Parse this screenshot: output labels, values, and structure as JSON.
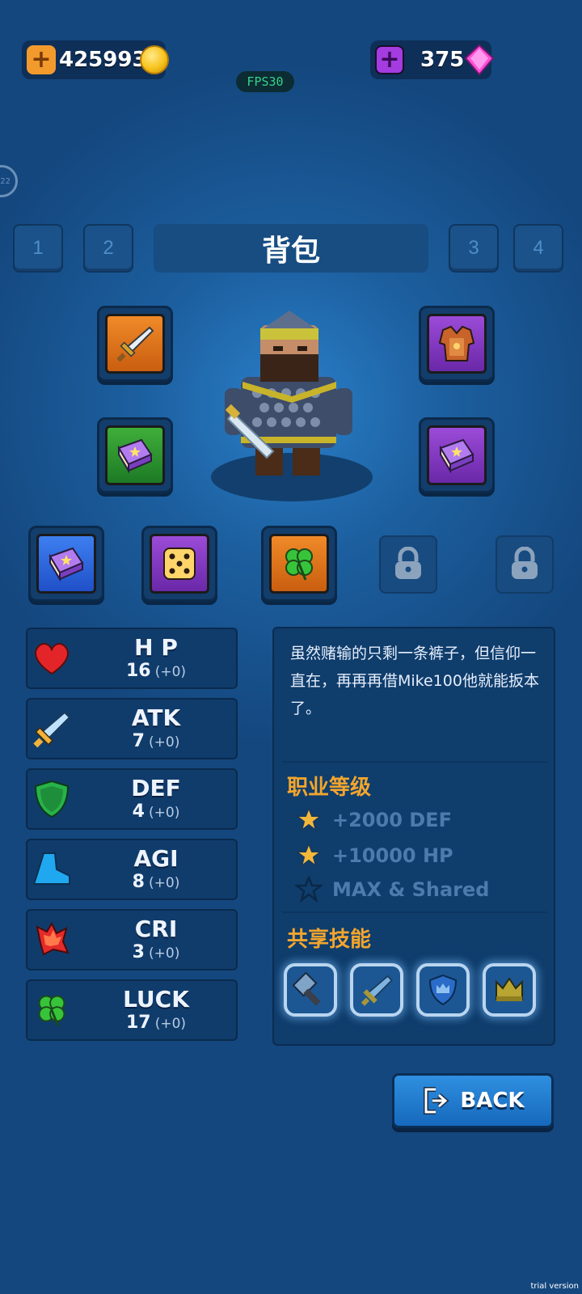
{
  "currency": {
    "gold": "425993",
    "gems": "375",
    "gold_plus_color": "#f39a2c",
    "gem_plus_color": "#a43ce0"
  },
  "fps": "FPS30",
  "side_badge": "22",
  "tabs": [
    "1",
    "2",
    "3",
    "4"
  ],
  "title": "背包",
  "equipment": [
    {
      "icon": "sword-icon",
      "frame": "orange"
    },
    {
      "icon": "armor-icon",
      "frame": "purple"
    },
    {
      "icon": "spellbook-icon",
      "frame": "green"
    },
    {
      "icon": "spellbook-icon",
      "frame": "purple"
    },
    {
      "icon": "spellbook-icon",
      "frame": "blue"
    },
    {
      "icon": "dice-icon",
      "frame": "purple"
    },
    {
      "icon": "clover-icon",
      "frame": "orange"
    },
    {
      "icon": "lock-icon",
      "frame": "locked"
    },
    {
      "icon": "lock-icon",
      "frame": "locked"
    }
  ],
  "stats": [
    {
      "name": "H P",
      "value": "16",
      "bonus": "(+0)",
      "icon": "heart-icon"
    },
    {
      "name": "ATK",
      "value": "7",
      "bonus": "(+0)",
      "icon": "sword-icon"
    },
    {
      "name": "DEF",
      "value": "4",
      "bonus": "(+0)",
      "icon": "shield-icon"
    },
    {
      "name": "AGI",
      "value": "8",
      "bonus": "(+0)",
      "icon": "boot-icon"
    },
    {
      "name": "CRI",
      "value": "3",
      "bonus": "(+0)",
      "icon": "critical-burst-icon"
    },
    {
      "name": "LUCK",
      "value": "17",
      "bonus": "(+0)",
      "icon": "clover-icon"
    }
  ],
  "info": {
    "description": "虽然赌输的只剩一条裤子，但信仰一直在，再再再借Mike100他就能扳本了。",
    "rank_title": "职业等级",
    "rank_lines": [
      {
        "text": "+2000 DEF",
        "star": "filled"
      },
      {
        "text": "+10000 HP",
        "star": "filled"
      },
      {
        "text": "MAX & Shared",
        "star": "empty"
      }
    ],
    "skills_title": "共享技能",
    "skills": [
      "hammer-icon",
      "sword-icon",
      "crown-shield-icon",
      "crown-icon"
    ]
  },
  "back_button": "BACK",
  "watermark": "trial version"
}
